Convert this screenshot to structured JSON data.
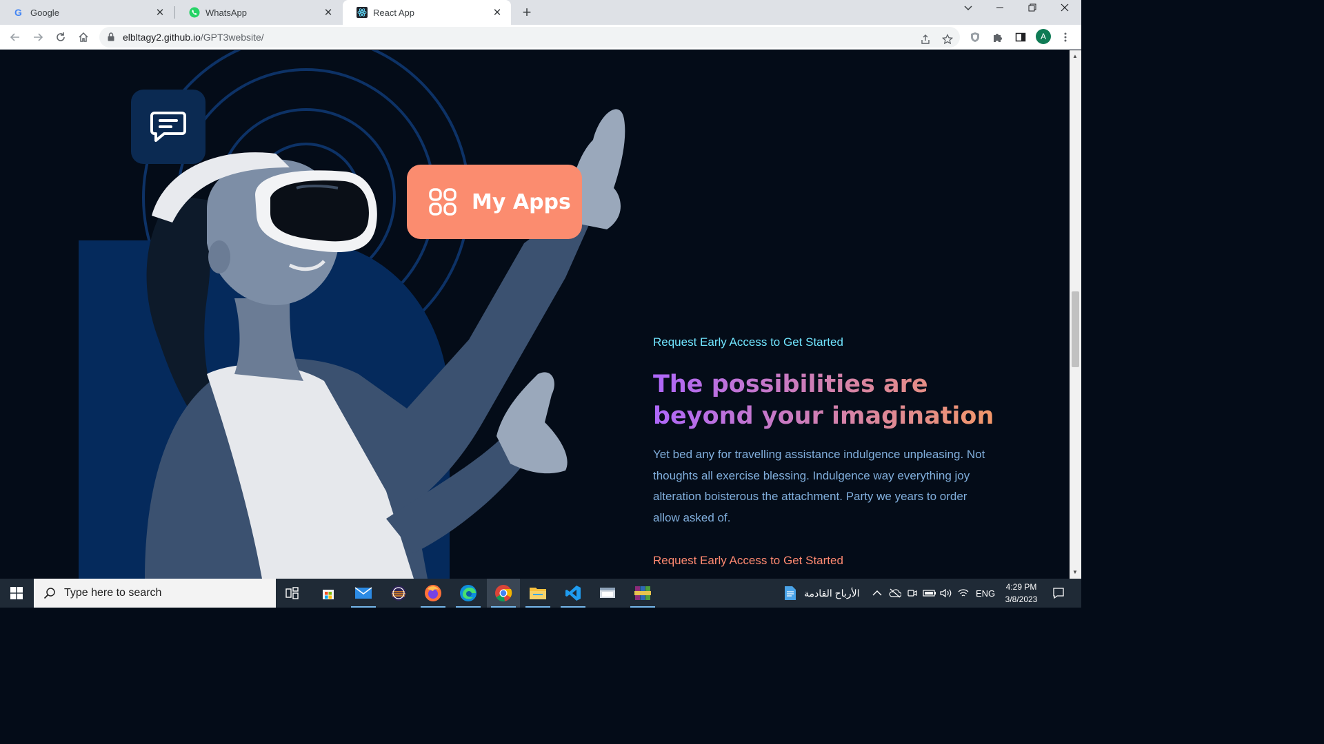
{
  "browser": {
    "tabs": [
      {
        "title": "Google",
        "active": false
      },
      {
        "title": "WhatsApp",
        "active": false
      },
      {
        "title": "React App",
        "active": true
      }
    ],
    "new_tab_symbol": "+",
    "url_host": "elbltagy2.github.io",
    "url_path": "/GPT3website/",
    "profile_initial": "A"
  },
  "page": {
    "my_apps_label": "My Apps",
    "link_top": "Request Early Access to Get Started",
    "headline": "The possibilities are beyond your imagination",
    "body": "Yet bed any for travelling assistance indulgence unpleasing. Not thoughts all exercise blessing. Indulgence way everything joy alteration boisterous the attachment. Party we years to order allow asked of.",
    "link_bottom": "Request Early Access to Get Started",
    "colors": {
      "background": "#040c18",
      "accent_cyan": "#71e5ff",
      "gradient_start": "#ae67fa",
      "gradient_end": "#f49867",
      "body_text": "#81afdd",
      "cta_orange": "#ff8a71",
      "my_apps_bg": "#fb8c6f",
      "chat_badge_bg": "#0b2a52"
    }
  },
  "taskbar": {
    "search_placeholder": "Type here to search",
    "news_text": "الأرباح القادمة",
    "language": "ENG",
    "time": "4:29 PM",
    "date": "3/8/2023"
  }
}
